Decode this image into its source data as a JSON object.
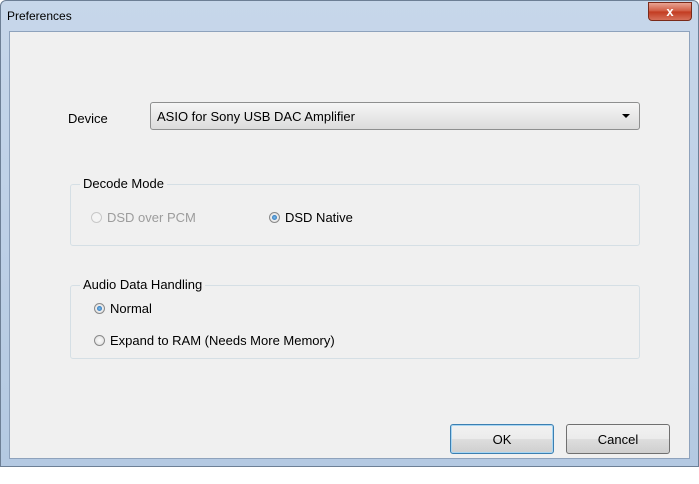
{
  "window": {
    "title": "Preferences",
    "close_label": "x"
  },
  "device": {
    "label": "Device",
    "selected": "ASIO for Sony USB DAC Amplifier"
  },
  "decode_mode": {
    "title": "Decode Mode",
    "options": [
      {
        "label": "DSD over PCM",
        "checked": false,
        "disabled": true
      },
      {
        "label": "DSD Native",
        "checked": true,
        "disabled": false
      }
    ]
  },
  "audio_handling": {
    "title": "Audio Data Handling",
    "options": [
      {
        "label": "Normal",
        "checked": true
      },
      {
        "label": "Expand to RAM (Needs More Memory)",
        "checked": false
      }
    ]
  },
  "buttons": {
    "ok": "OK",
    "cancel": "Cancel"
  }
}
